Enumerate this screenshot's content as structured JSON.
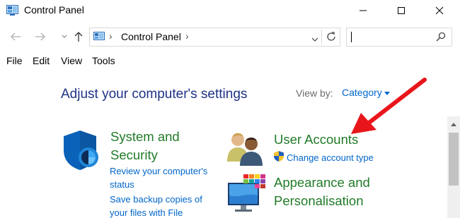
{
  "window": {
    "title": "Control Panel"
  },
  "address": {
    "path": [
      "Control Panel"
    ],
    "search_placeholder": ""
  },
  "menu": {
    "items": [
      "File",
      "Edit",
      "View",
      "Tools"
    ]
  },
  "content": {
    "heading": "Adjust your computer's settings",
    "view_by_label": "View by:",
    "view_by_value": "Category",
    "categories": [
      {
        "title_line1": "System and",
        "title_line2": "Security",
        "icon": "shield-icon",
        "links": [
          {
            "line1": "Review your computer's",
            "line2": "status"
          },
          {
            "line1": "Save backup copies of",
            "line2": "your files with File"
          }
        ]
      },
      {
        "title_line1": "User Accounts",
        "icon": "users-icon",
        "links": [
          {
            "line1": "Change account type",
            "icon": "uac-shield-icon"
          }
        ]
      },
      {
        "title_line1": "Appearance and",
        "title_line2": "Personalisation",
        "icon": "monitor-icon"
      }
    ]
  },
  "colors": {
    "heading": "#1e3287",
    "category_title": "#217b28",
    "link": "#0066cc",
    "annotation_arrow": "#e8161b"
  }
}
